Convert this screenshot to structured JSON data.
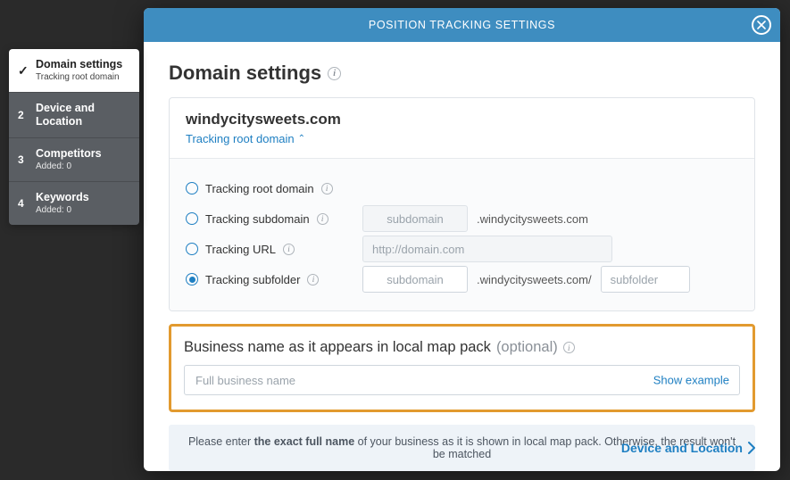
{
  "modal": {
    "title": "POSITION TRACKING SETTINGS"
  },
  "stepper": {
    "items": [
      {
        "label": "Domain settings",
        "sub": "Tracking root domain"
      },
      {
        "label": "Device and Location",
        "sub": ""
      },
      {
        "label": "Competitors",
        "sub": "Added: 0"
      },
      {
        "label": "Keywords",
        "sub": "Added: 0"
      }
    ]
  },
  "section": {
    "title": "Domain settings"
  },
  "domain": {
    "name": "windycitysweets.com",
    "toggle_label": "Tracking root domain"
  },
  "tracking_options": {
    "root": "Tracking root domain",
    "subdomain": "Tracking subdomain",
    "url": "Tracking URL",
    "subfolder": "Tracking subfolder",
    "subdomain_placeholder": "subdomain",
    "subdomain_suffix": ".windycitysweets.com",
    "url_placeholder": "http://domain.com",
    "subfolder_sub_placeholder": "subdomain",
    "subfolder_mid": ".windycitysweets.com/",
    "subfolder_placeholder": "subfolder"
  },
  "business": {
    "label_main": "Business name as it appears in local map pack",
    "label_optional": "(optional)",
    "placeholder": "Full business name",
    "show_example": "Show example"
  },
  "note": {
    "prefix": "Please enter ",
    "bold": "the exact full name",
    "suffix": " of your business as it is shown in local map pack. Otherwise, the result won't be matched"
  },
  "footer": {
    "next_label": "Device and Location"
  }
}
